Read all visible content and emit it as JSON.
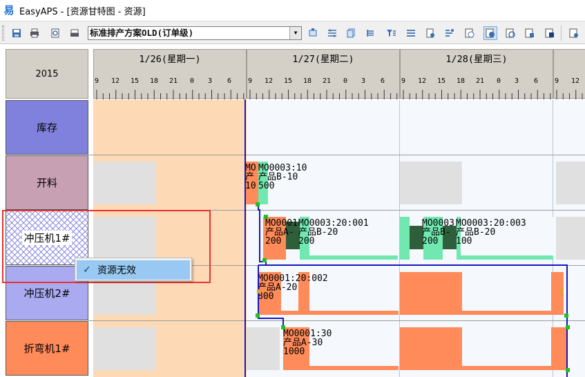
{
  "window": {
    "app_icon": "easyaps-logo-icon",
    "title": "EasyAPS - [资源甘特图 - 资源]"
  },
  "toolbar": {
    "plan_select": {
      "value": "标准排产方案OLD(订单级)",
      "arrow": "▼"
    },
    "buttons": [
      "save-icon",
      "print-icon",
      "print-preview-icon",
      "print-setup-icon",
      "refresh-icon",
      "lines-icon",
      "copy-icon",
      "indent-icon",
      "filter-icon",
      "list-icon",
      "doc-icon",
      "settings-icon",
      "clock-icon",
      "view-a-icon",
      "view-b-icon",
      "view-c-icon",
      "view-d-icon",
      "view-e-icon"
    ]
  },
  "gantt": {
    "year": "2015",
    "days": [
      {
        "label": "1/26(星期一)",
        "hours": [
          "9",
          "12",
          "15",
          "18",
          "21",
          "0",
          "3",
          "6"
        ]
      },
      {
        "label": "1/27(星期二)",
        "hours": [
          "9",
          "12",
          "15",
          "18",
          "21",
          "0",
          "3",
          "6"
        ]
      },
      {
        "label": "1/28(星期三)",
        "hours": [
          "9",
          "12",
          "15",
          "18",
          "21",
          "0",
          "3",
          "6"
        ]
      },
      {
        "label": "",
        "hours": [
          "9",
          "12"
        ]
      }
    ],
    "resources": [
      {
        "name": "库存",
        "color": "#8080dd"
      },
      {
        "name": "开料",
        "color": "#c8a0b4"
      },
      {
        "name": "冲压机1#",
        "color": "#ffffff"
      },
      {
        "name": "冲压机2#",
        "color": "#aaaaf0"
      },
      {
        "name": "折弯机1#",
        "color": "#ff8a5a"
      }
    ],
    "operations": {
      "kailiao_a": {
        "line1": "MO",
        "line2": "产",
        "line3": "10"
      },
      "kailiao_b": {
        "line1": "MO0003:10",
        "line2": "产品B-10",
        "line3": "500"
      },
      "press1_a": {
        "line1": "MO0001",
        "line2": "产品A-",
        "line3": "200"
      },
      "press1_b": {
        "line1": "MO0003:20:001",
        "line2": "产品B-20",
        "line3": "200"
      },
      "press1_c": {
        "line1": "MO0003",
        "line2": "产品B-",
        "line3": "200"
      },
      "press1_d": {
        "line1": "MO0003:20:003",
        "line2": "产品B-20",
        "line3": "100"
      },
      "press2_a": {
        "line1": "MO0001:20:002",
        "line2": "产品A-20",
        "line3": "800"
      },
      "bend_a": {
        "line1": "MO0001:30",
        "line2": "产品A-30",
        "line3": "1000"
      }
    },
    "colors": {
      "past": "#fdd9b5",
      "operation": "#ff8a5a",
      "setup": "#70e8b0",
      "dark": "#2e5e3a",
      "link": "#1515c0",
      "idle": "#e0e0e0"
    }
  },
  "context_menu": {
    "check": "✓",
    "label": "资源无效"
  }
}
